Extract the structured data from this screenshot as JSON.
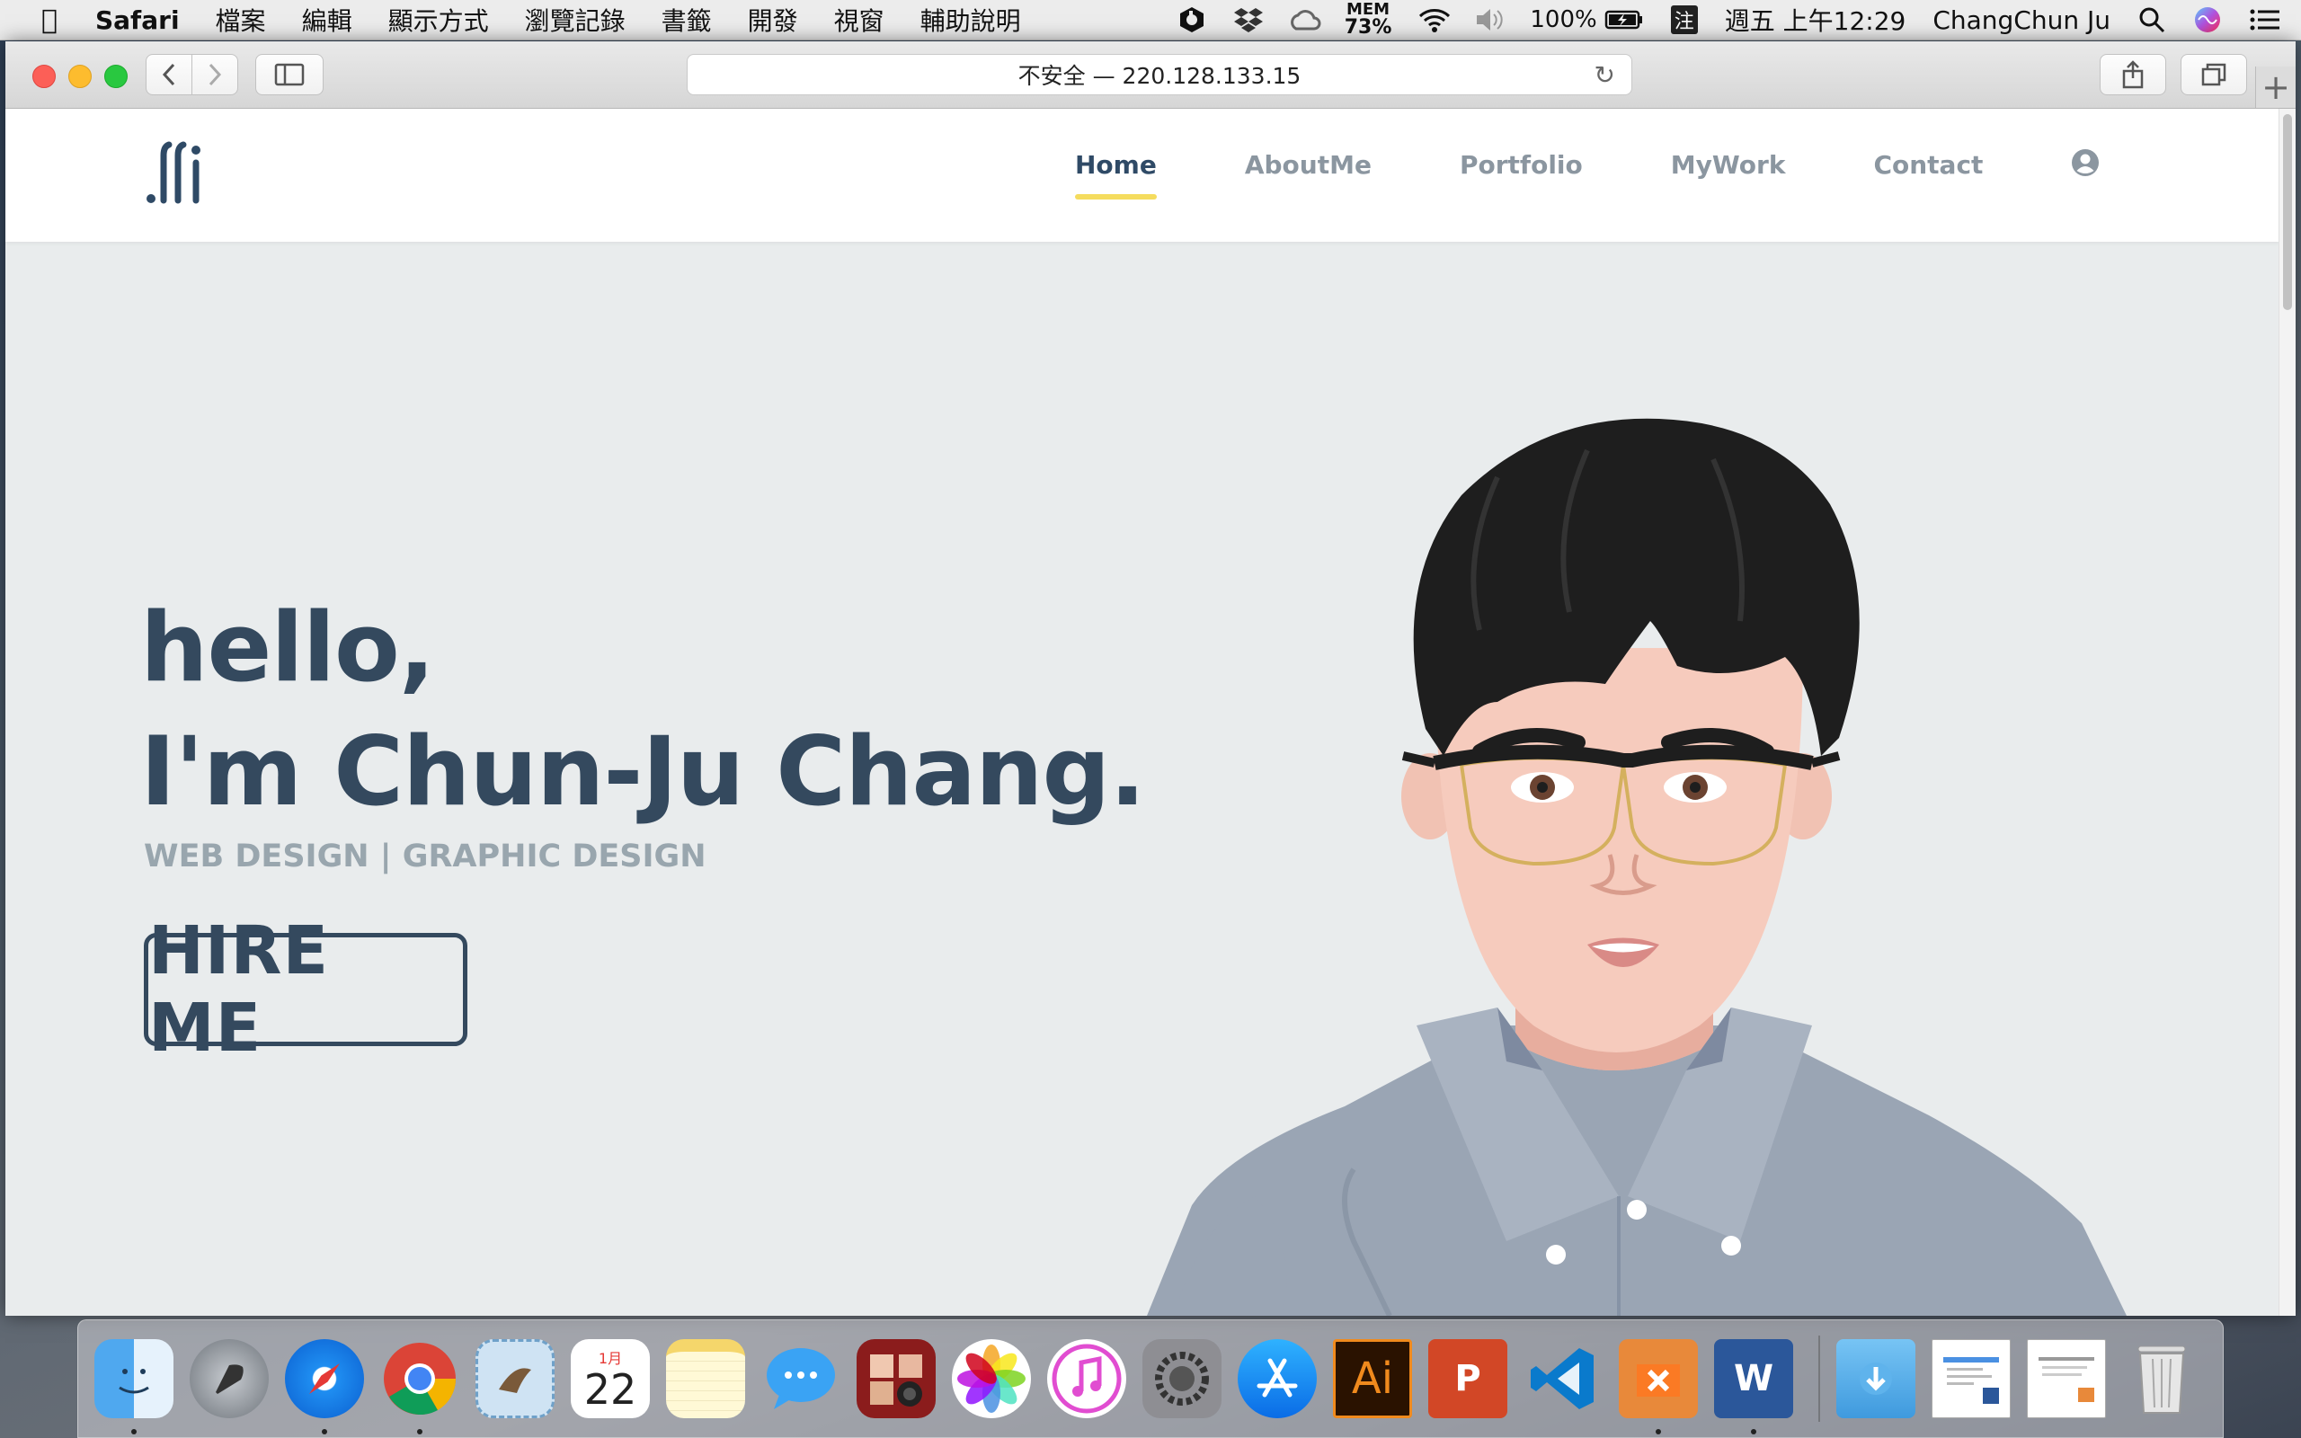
{
  "menubar": {
    "app": "Safari",
    "items": [
      "檔案",
      "編輯",
      "顯示方式",
      "瀏覽記錄",
      "書籤",
      "開發",
      "視窗",
      "輔助說明"
    ],
    "mem_label": "MEM",
    "mem_value": "73%",
    "battery": "100%",
    "input_method": "注",
    "clock": "週五 上午12:29",
    "user": "ChangChun Ju"
  },
  "browser": {
    "address": "不安全 — 220.128.133.15"
  },
  "site": {
    "nav": [
      "Home",
      "AboutMe",
      "Portfolio",
      "MyWork",
      "Contact"
    ],
    "active_nav": "Home",
    "hero_line1": "hello,",
    "hero_line2": "I'm Chun-Ju Chang.",
    "subtitle": "WEB DESIGN | GRAPHIC DESIGN",
    "cta": "HIRE ME"
  },
  "dock": {
    "calendar_month": "1月",
    "calendar_day": "22",
    "illustrator": "Ai",
    "powerpoint": "P",
    "word": "W"
  },
  "colors": {
    "primary": "#34495e",
    "accent_underline": "#f5dc5e",
    "page_bg": "#e9eced",
    "nav_inactive": "#8b96a0",
    "subtitle": "#99a6ae"
  }
}
